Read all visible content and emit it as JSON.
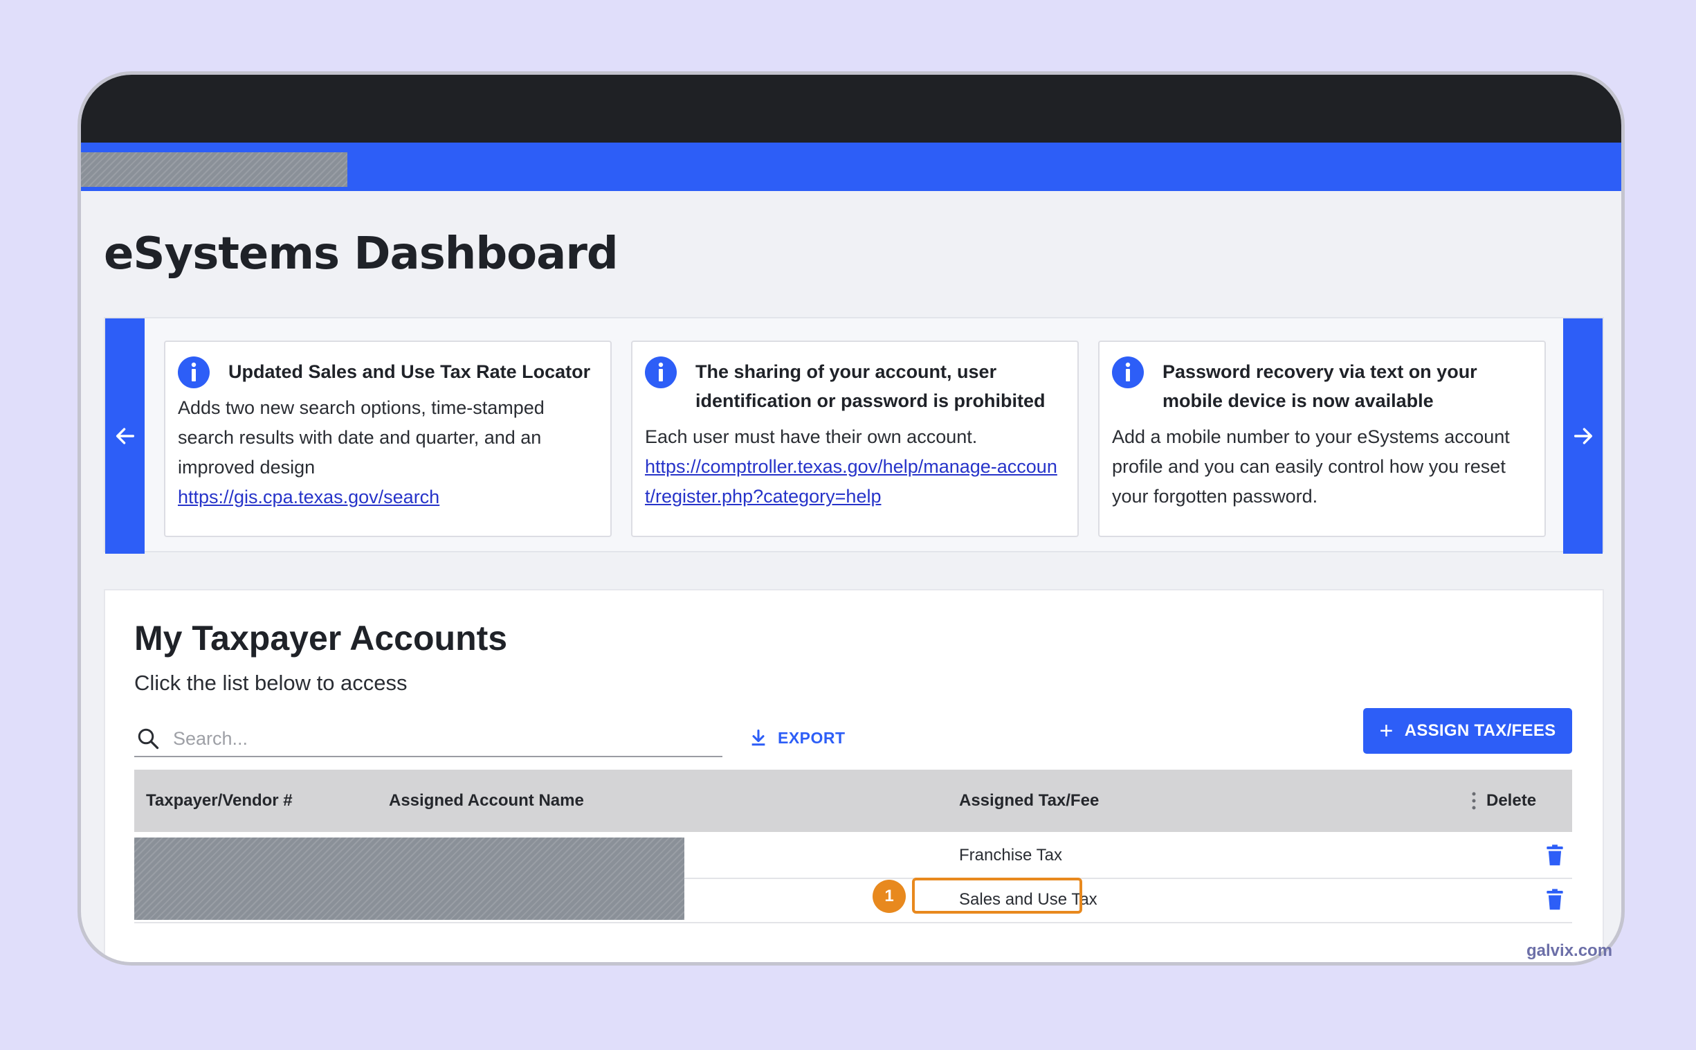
{
  "page": {
    "title": "eSystems Dashboard"
  },
  "announcements": [
    {
      "title": "Updated Sales and Use Tax Rate Locator",
      "body": "Adds two new search options, time-stamped search results with date and quarter, and an improved design",
      "link": "https://gis.cpa.texas.gov/search"
    },
    {
      "title": "The sharing of your account, user identification or password is prohibited",
      "body": "Each user must have their own account.",
      "link": "https://comptroller.texas.gov/help/manage-account/register.php?category=help"
    },
    {
      "title": "Password recovery via text on your mobile device is now available",
      "body": "Add a mobile number to your eSystems account profile and you can easily control how you reset your forgotten password.",
      "link": ""
    }
  ],
  "accounts": {
    "title": "My Taxpayer Accounts",
    "subtitle": "Click the list below to access",
    "search_placeholder": "Search...",
    "export_label": "EXPORT",
    "assign_label": "ASSIGN TAX/FEES",
    "columns": {
      "vendor": "Taxpayer/Vendor #",
      "name": "Assigned Account Name",
      "tax": "Assigned Tax/Fee",
      "delete": "Delete"
    },
    "rows": [
      {
        "tax": "Franchise Tax"
      },
      {
        "tax": "Sales and Use Tax"
      }
    ]
  },
  "callout": {
    "step": "1"
  },
  "watermark": "galvix.com",
  "colors": {
    "accent": "#2d5ef7",
    "topbar": "#1f2125",
    "highlight": "#e8891e",
    "background": "#e0defa"
  },
  "icons": {
    "carousel_prev": "arrow-left-icon",
    "carousel_next": "arrow-right-icon",
    "card": "info-icon",
    "search": "search-icon",
    "export": "download-icon",
    "delete": "trash-icon",
    "column_menu": "kebab-menu-icon"
  }
}
